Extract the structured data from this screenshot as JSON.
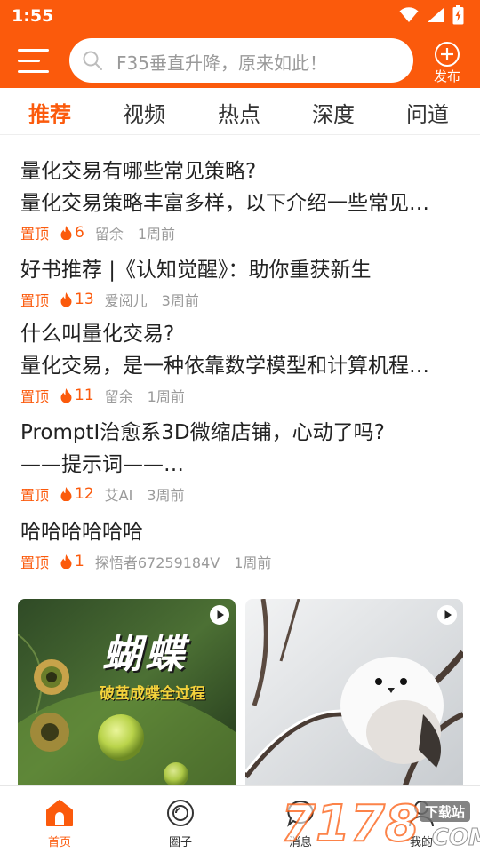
{
  "status_bar": {
    "time": "1:55"
  },
  "header": {
    "search_placeholder": "F35垂直升降，原来如此！",
    "publish_label": "发布",
    "brand_color": "#fb5a0c"
  },
  "tabs": [
    {
      "label": "推荐",
      "active": true
    },
    {
      "label": "视频"
    },
    {
      "label": "热点"
    },
    {
      "label": "深度"
    },
    {
      "label": "问道"
    }
  ],
  "articles": [
    {
      "title": "量化交易有哪些常见策略?",
      "summary": "量化交易策略丰富多样，以下介绍一些常见的量化交易策略",
      "pin": "置顶",
      "hot": "6",
      "author": "留余",
      "time": "1周前"
    },
    {
      "title": "好书推荐 |《认知觉醒》：助你重获新生",
      "summary": "",
      "pin": "置顶",
      "hot": "13",
      "author": "爱阅儿",
      "time": "3周前"
    },
    {
      "title": "什么叫量化交易?",
      "summary": "量化交易，是一种依靠数学模型和计算机程序进行交易的方式",
      "pin": "置顶",
      "hot": "11",
      "author": "留余",
      "time": "1周前"
    },
    {
      "title": "PromptⅠ治愈系3D微缩店铺，心动了吗?",
      "summary": "——提示词——…",
      "pin": "置顶",
      "hot": "12",
      "author": "艾AI",
      "time": "3周前"
    },
    {
      "title": "哈哈哈哈哈哈",
      "summary": "",
      "pin": "置顶",
      "hot": "1",
      "author": "探悟者67259184V",
      "time": "1周前"
    }
  ],
  "videos": [
    {
      "overlay_title": "蝴蝶",
      "overlay_subtitle": "破茧成蝶全过程",
      "icon": "play-icon"
    },
    {
      "overlay_title": "",
      "overlay_subtitle": "",
      "icon": "play-icon"
    }
  ],
  "bottom_nav": [
    {
      "label": "首页",
      "icon": "home-icon",
      "active": true
    },
    {
      "label": "圈子",
      "icon": "circle-icon"
    },
    {
      "label": "消息",
      "icon": "message-icon"
    },
    {
      "label": "我的",
      "icon": "user-icon"
    }
  ],
  "watermark": {
    "brand": "7178",
    "domain": ".COM",
    "badge": "下载站"
  }
}
